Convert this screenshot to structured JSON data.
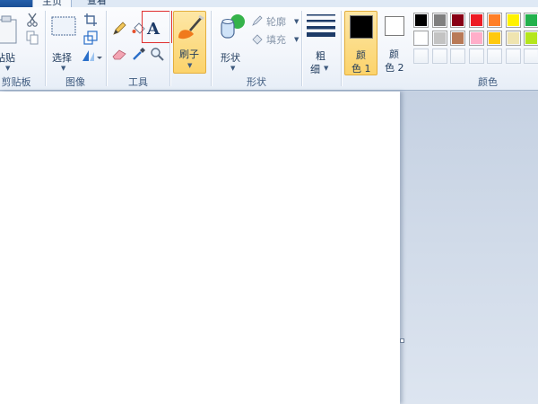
{
  "tabs": {
    "home": "主页",
    "view": "查看"
  },
  "clipboard": {
    "paste": "粘贴",
    "label": "剪贴板"
  },
  "image": {
    "select": "选择",
    "label": "图像"
  },
  "tools": {
    "label": "工具",
    "text_glyph": "A"
  },
  "brush": {
    "label": "刷子"
  },
  "shapes": {
    "shape": "形状",
    "outline": "轮廓",
    "fill": "填充",
    "label": "形状"
  },
  "size": {
    "line1": "粗",
    "line2": "细"
  },
  "color1": {
    "line1": "颜",
    "line2": "色 1"
  },
  "color2": {
    "line1": "颜",
    "line2": "色 2"
  },
  "colors": {
    "label": "颜色",
    "row1": [
      "#000000",
      "#7f7f7f",
      "#880015",
      "#ed1c24",
      "#ff7f27",
      "#fff200",
      "#22b14c"
    ],
    "row2": [
      "#ffffff",
      "#c3c3c3",
      "#b97a57",
      "#ffaec9",
      "#ffc90e",
      "#efe4b0",
      "#b5e61d"
    ],
    "row3": [
      "#ffffff",
      "#ffffff",
      "#ffffff",
      "#ffffff",
      "#ffffff",
      "#ffffff",
      "#ffffff"
    ],
    "primary": "#000000",
    "secondary": "#ffffff",
    "highlight": "#e03030"
  }
}
